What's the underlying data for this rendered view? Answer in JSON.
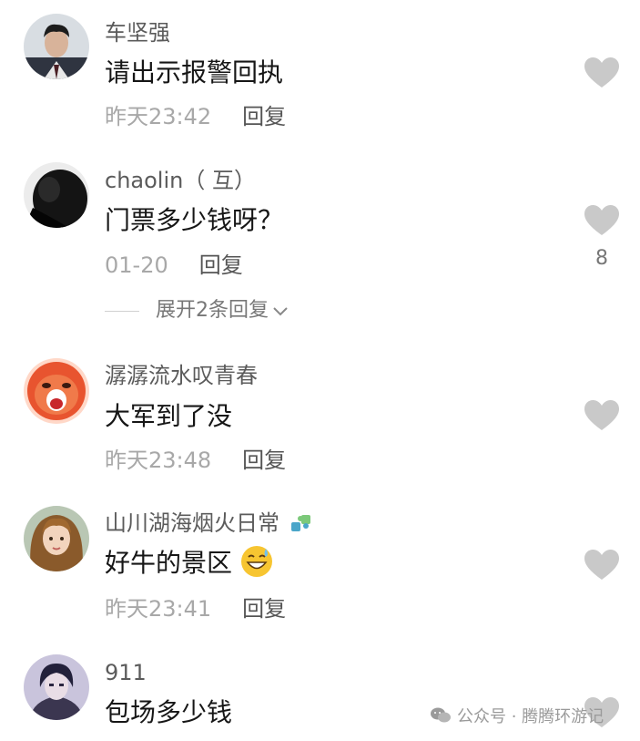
{
  "comments": [
    {
      "username": "车坚强",
      "text": "请出示报警回执",
      "time": "昨天23:42",
      "reply_label": "回复",
      "like_count": ""
    },
    {
      "username": "chaolin（ 互）",
      "text": "门票多少钱呀？",
      "time": "01-20",
      "reply_label": "回复",
      "like_count": "8",
      "expand_label": "展开2条回复"
    },
    {
      "username": "潺潺流水叹青春",
      "text": "大军到了没",
      "time": "昨天23:48",
      "reply_label": "回复",
      "like_count": ""
    },
    {
      "username": "山川湖海烟火日常",
      "text": "好牛的景区",
      "time": "昨天23:41",
      "reply_label": "回复",
      "like_count": ""
    },
    {
      "username": "911",
      "text": "包场多少钱",
      "time": "",
      "reply_label": "",
      "like_count": ""
    }
  ],
  "watermark": {
    "text": "公众号 · 腾腾环游记",
    "icon": "wechat-icon"
  },
  "icons": {
    "like": "heart-icon",
    "expand": "chevron-down-icon"
  },
  "colors": {
    "heart": "#c9c9c9",
    "text": "#161616",
    "meta": "#a8a8a8"
  }
}
